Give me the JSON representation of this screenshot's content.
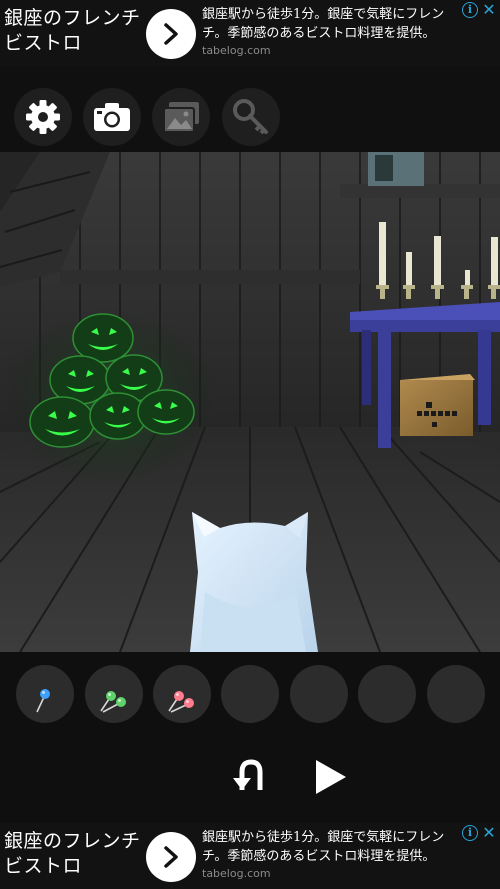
{
  "ad_top": {
    "title": "銀座のフレンチビストロ",
    "line1": "銀座駅から徒歩1分。銀座で気軽にフレン",
    "line2": "チ。季節感のあるビストロ料理を提供。",
    "domain": "tabelog.com",
    "info_glyph": "i",
    "close_glyph": "✕"
  },
  "ad_bottom": {
    "title": "銀座のフレンチビストロ",
    "line1": "銀座駅から徒歩1分。銀座で気軽にフレン",
    "line2": "チ。季節感のあるビストロ料理を提供。",
    "domain": "tabelog.com",
    "info_glyph": "i",
    "close_glyph": "✕"
  },
  "toolbar": {
    "buttons": [
      {
        "icon": "gear-icon",
        "enabled": true
      },
      {
        "icon": "camera-icon",
        "enabled": true
      },
      {
        "icon": "photo-album-icon",
        "enabled": false
      },
      {
        "icon": "key-icon",
        "enabled": false
      }
    ]
  },
  "scene": {
    "description_icons": [
      "jack-o-lantern-pile",
      "candle-table",
      "code-lock-box",
      "white-cat"
    ],
    "lantern_glow_color": "#39ff4a",
    "table_color": "#3b3f9a"
  },
  "inventory": {
    "slots": [
      {
        "item": "blue-pin-item",
        "color": "#3ea0ff"
      },
      {
        "item": "green-pins-item",
        "color": "#5fd36a"
      },
      {
        "item": "pink-pins-item",
        "color": "#ff7b8e"
      },
      {
        "item": null
      },
      {
        "item": null
      },
      {
        "item": null
      },
      {
        "item": null
      }
    ]
  },
  "controls": {
    "back": "u-turn-icon",
    "forward": "play-icon"
  },
  "colors": {
    "background": "#0f0f0f",
    "slot": "#2c2c2c",
    "ad_accent": "#2aa4d8"
  }
}
